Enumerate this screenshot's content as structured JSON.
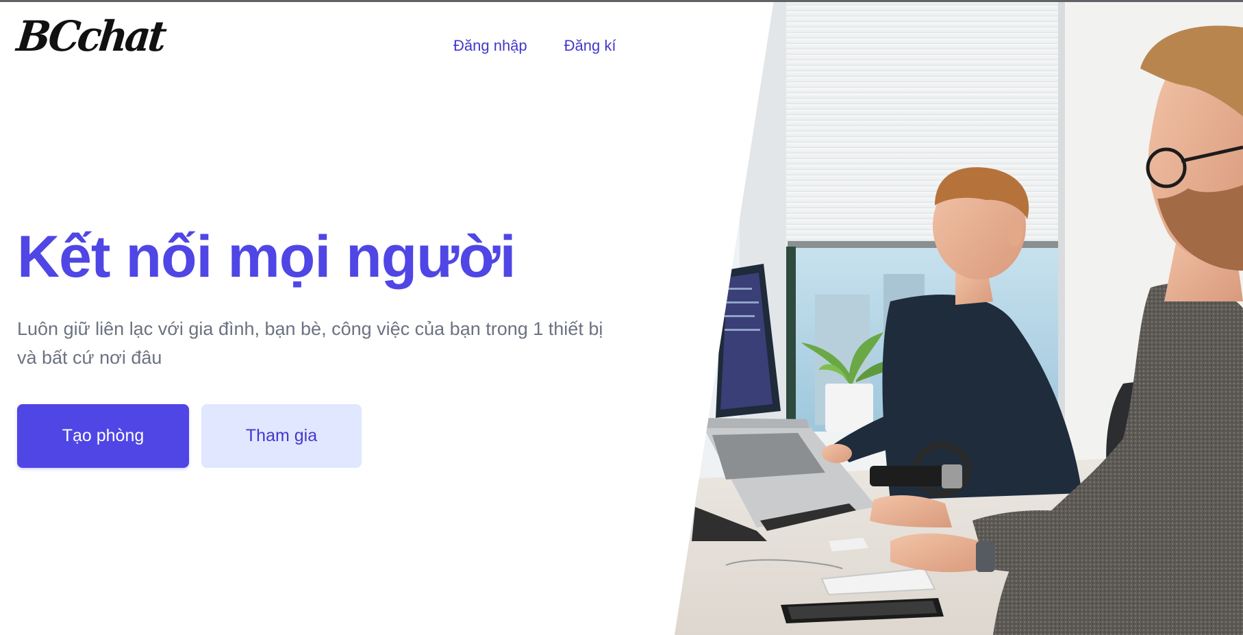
{
  "brand": {
    "logo_text": "BCchat"
  },
  "nav": {
    "login_label": "Đăng nhập",
    "register_label": "Đăng kí"
  },
  "hero": {
    "title": "Kết nối mọi người",
    "subtitle": "Luôn giữ liên lạc với gia đình, bạn bè, công việc của bạn trong 1 thiết bị và bất cứ nơi đâu",
    "create_room_label": "Tạo phòng",
    "join_label": "Tham gia",
    "image_description": "office-photo-two-men-working-at-laptops"
  },
  "colors": {
    "accent": "#4f46e5",
    "nav_link": "#4338ca",
    "secondary_button_bg": "#e0e7ff",
    "subtitle": "#6b7280"
  }
}
